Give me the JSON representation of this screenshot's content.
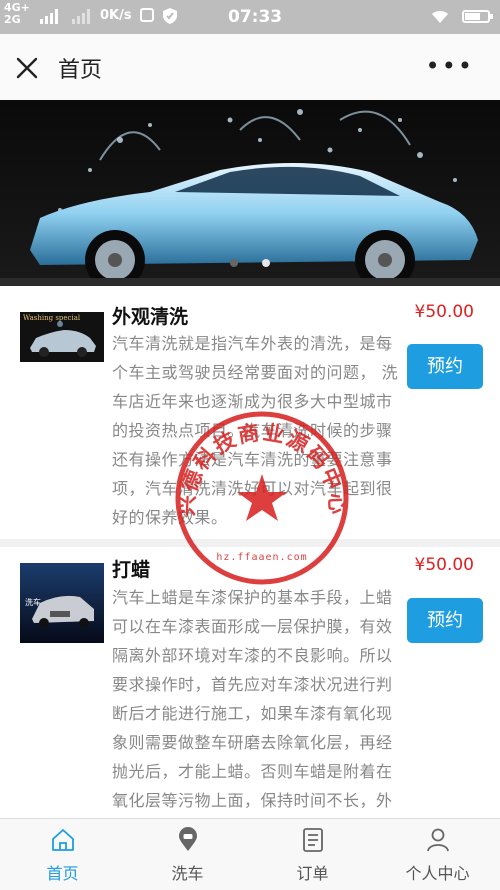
{
  "status_bar": {
    "network_top": "4G+",
    "network_bottom": "2G",
    "speed": "0K/s",
    "time": "07:33",
    "battery_level": 0.7
  },
  "header": {
    "title": "首页",
    "close_icon": "close-icon",
    "more_icon": "more-icon"
  },
  "banner": {
    "slide_count": 2,
    "active_slide": 2
  },
  "services": [
    {
      "name": "外观清洗",
      "price": "¥50.00",
      "description": "汽车清洗就是指汽车外表的清洗，是每个车主或驾驶员经常要面对的问题， 洗车店近年来也逐渐成为很多大中型城市的投资热点项目。汽车清洗时候的步骤还有操作方法是汽车清洗的重要注意事项，汽车清洗清洗好可以对汽车起到很好的保养效果。",
      "button_label": "预约",
      "thumb_text": "Washing special"
    },
    {
      "name": "打蜡",
      "price": "¥50.00",
      "description": "汽车上蜡是车漆保护的基本手段，上蜡可以在车漆表面形成一层保护膜，有效隔离外部环境对车漆的不良影响。所以要求操作时，首先应对车漆状况进行判断后才能进行施工，如果车漆有氧化现象则需要做整车研磨去除氧化层，再经抛光后，才能上蜡。否则车蜡是附着在氧化层等污物上面，保持时间不长，外",
      "button_label": "预约",
      "thumb_text": "洗车"
    }
  ],
  "stamp": {
    "text": "兴德科技商业源码中心",
    "url": "hz.ffaaen.com",
    "color": "#d81e1e"
  },
  "tabs": [
    {
      "label": "首页",
      "icon": "home-icon",
      "active": true
    },
    {
      "label": "洗车",
      "icon": "location-pin-icon",
      "active": false
    },
    {
      "label": "订单",
      "icon": "order-list-icon",
      "active": false
    },
    {
      "label": "个人中心",
      "icon": "user-icon",
      "active": false
    }
  ],
  "colors": {
    "accent": "#1e9de0",
    "price": "#e02020"
  }
}
